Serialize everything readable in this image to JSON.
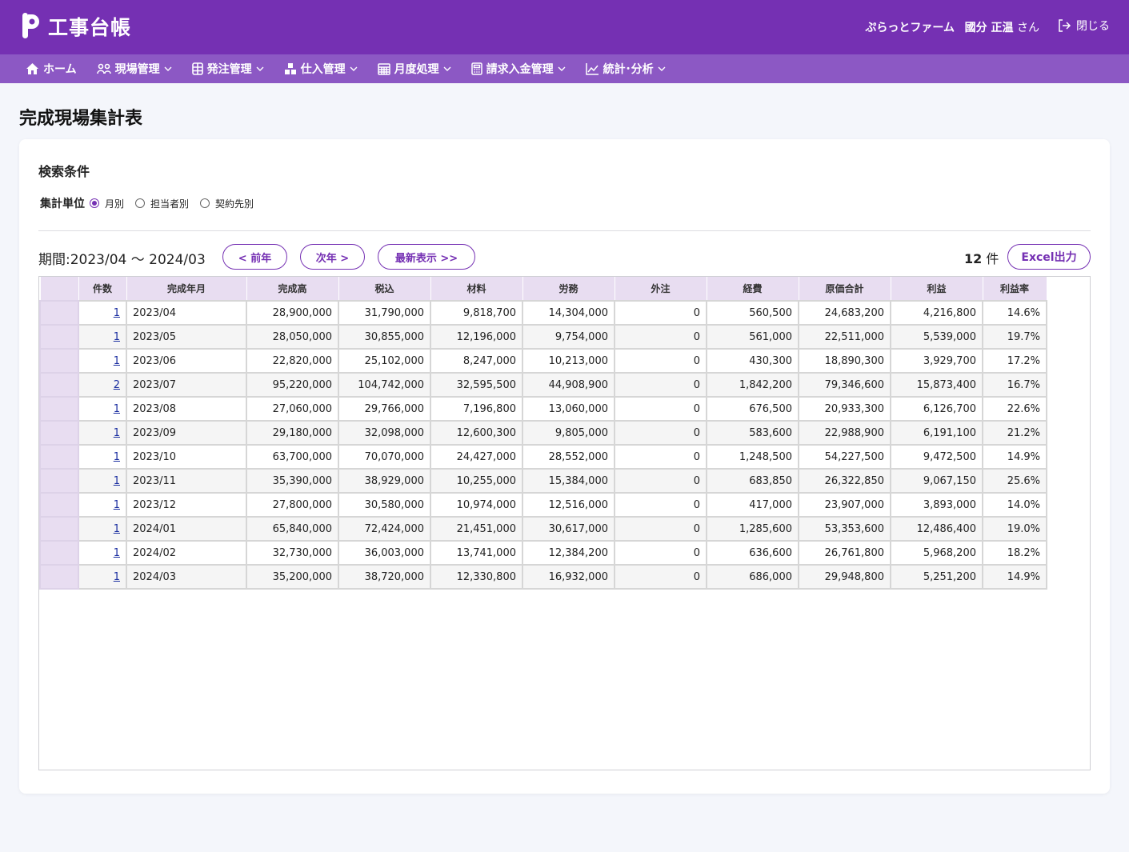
{
  "app": {
    "title": "工事台帳",
    "company": "ぷらっとファーム",
    "user_name": "國分 正温",
    "user_suffix": "さん",
    "close_label": "閉じる"
  },
  "nav": {
    "items": [
      {
        "label": "ホーム",
        "icon": "home-icon",
        "dropdown": false
      },
      {
        "label": "現場管理",
        "icon": "workers-icon",
        "dropdown": true
      },
      {
        "label": "発注管理",
        "icon": "grid-icon",
        "dropdown": true
      },
      {
        "label": "仕入管理",
        "icon": "boxes-icon",
        "dropdown": true
      },
      {
        "label": "月度処理",
        "icon": "calendar-icon",
        "dropdown": true
      },
      {
        "label": "請求入金管理",
        "icon": "calculator-icon",
        "dropdown": true
      },
      {
        "label": "統計･分析",
        "icon": "chart-icon",
        "dropdown": true
      }
    ]
  },
  "page": {
    "title": "完成現場集計表"
  },
  "search": {
    "title": "検索条件",
    "unit_label": "集計単位",
    "options": [
      "月別",
      "担当者別",
      "契約先別"
    ],
    "selected": "月別"
  },
  "period": {
    "label": "期間:2023/04 ～ 2024/03",
    "prev_label": "< 前年",
    "next_label": "次年 >",
    "latest_label": "最新表示 >>",
    "count_value": "12",
    "count_unit": "件",
    "excel_label": "Excel出力"
  },
  "table": {
    "headers": [
      "件数",
      "完成年月",
      "完成高",
      "税込",
      "材料",
      "労務",
      "外注",
      "経費",
      "原価合計",
      "利益",
      "利益率"
    ],
    "rows": [
      [
        "1",
        "2023/04",
        "28,900,000",
        "31,790,000",
        "9,818,700",
        "14,304,000",
        "0",
        "560,500",
        "24,683,200",
        "4,216,800",
        "14.6%"
      ],
      [
        "1",
        "2023/05",
        "28,050,000",
        "30,855,000",
        "12,196,000",
        "9,754,000",
        "0",
        "561,000",
        "22,511,000",
        "5,539,000",
        "19.7%"
      ],
      [
        "1",
        "2023/06",
        "22,820,000",
        "25,102,000",
        "8,247,000",
        "10,213,000",
        "0",
        "430,300",
        "18,890,300",
        "3,929,700",
        "17.2%"
      ],
      [
        "2",
        "2023/07",
        "95,220,000",
        "104,742,000",
        "32,595,500",
        "44,908,900",
        "0",
        "1,842,200",
        "79,346,600",
        "15,873,400",
        "16.7%"
      ],
      [
        "1",
        "2023/08",
        "27,060,000",
        "29,766,000",
        "7,196,800",
        "13,060,000",
        "0",
        "676,500",
        "20,933,300",
        "6,126,700",
        "22.6%"
      ],
      [
        "1",
        "2023/09",
        "29,180,000",
        "32,098,000",
        "12,600,300",
        "9,805,000",
        "0",
        "583,600",
        "22,988,900",
        "6,191,100",
        "21.2%"
      ],
      [
        "1",
        "2023/10",
        "63,700,000",
        "70,070,000",
        "24,427,000",
        "28,552,000",
        "0",
        "1,248,500",
        "54,227,500",
        "9,472,500",
        "14.9%"
      ],
      [
        "1",
        "2023/11",
        "35,390,000",
        "38,929,000",
        "10,255,000",
        "15,384,000",
        "0",
        "683,850",
        "26,322,850",
        "9,067,150",
        "25.6%"
      ],
      [
        "1",
        "2023/12",
        "27,800,000",
        "30,580,000",
        "10,974,000",
        "12,516,000",
        "0",
        "417,000",
        "23,907,000",
        "3,893,000",
        "14.0%"
      ],
      [
        "1",
        "2024/01",
        "65,840,000",
        "72,424,000",
        "21,451,000",
        "30,617,000",
        "0",
        "1,285,600",
        "53,353,600",
        "12,486,400",
        "19.0%"
      ],
      [
        "1",
        "2024/02",
        "32,730,000",
        "36,003,000",
        "13,741,000",
        "12,384,200",
        "0",
        "636,600",
        "26,761,800",
        "5,968,200",
        "18.2%"
      ],
      [
        "1",
        "2024/03",
        "35,200,000",
        "38,720,000",
        "12,330,800",
        "16,932,000",
        "0",
        "686,000",
        "29,948,800",
        "5,251,200",
        "14.9%"
      ]
    ]
  }
}
